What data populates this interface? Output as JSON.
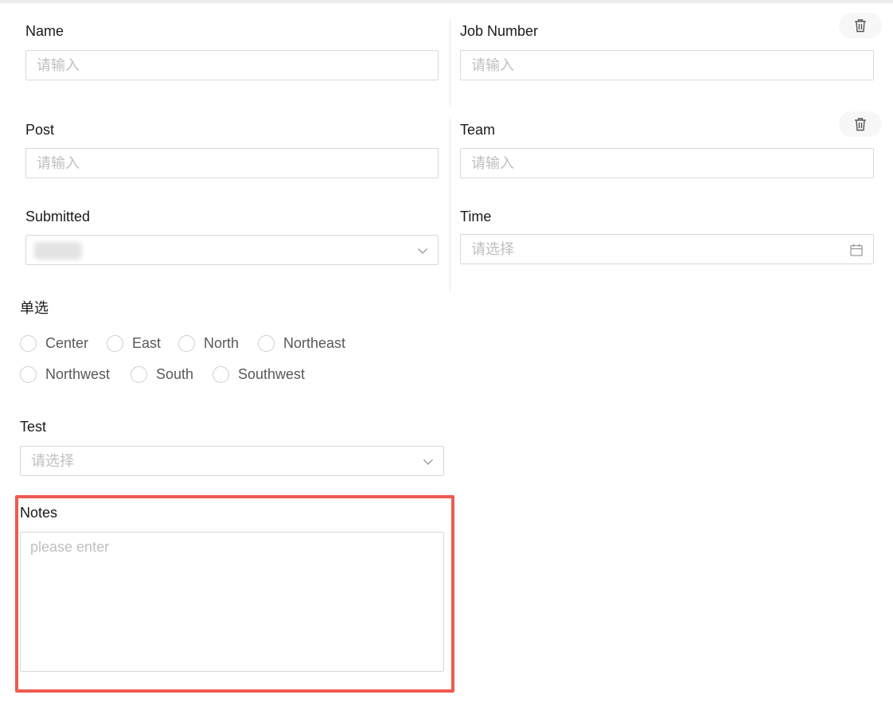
{
  "form": {
    "name": {
      "label": "Name",
      "placeholder": "请输入"
    },
    "job_number": {
      "label": "Job Number",
      "placeholder": "请输入"
    },
    "post": {
      "label": "Post",
      "placeholder": "请输入"
    },
    "team": {
      "label": "Team",
      "placeholder": "请输入"
    },
    "submitted": {
      "label": "Submitted",
      "value": ""
    },
    "time": {
      "label": "Time",
      "placeholder": "请选择"
    },
    "radio_group": {
      "label": "单选",
      "options": [
        "Center",
        "East",
        "North",
        "Northeast",
        "Northwest",
        "South",
        "Southwest"
      ]
    },
    "test": {
      "label": "Test",
      "placeholder": "请选择"
    },
    "notes": {
      "label": "Notes",
      "placeholder": "please enter"
    }
  },
  "icons": {
    "delete": "trash-icon",
    "dropdown": "chevron-down-icon",
    "calendar": "calendar-icon"
  },
  "colors": {
    "highlight_border": "#f05a4f",
    "input_border": "#d9d9d9",
    "placeholder": "#bfbfbf"
  }
}
